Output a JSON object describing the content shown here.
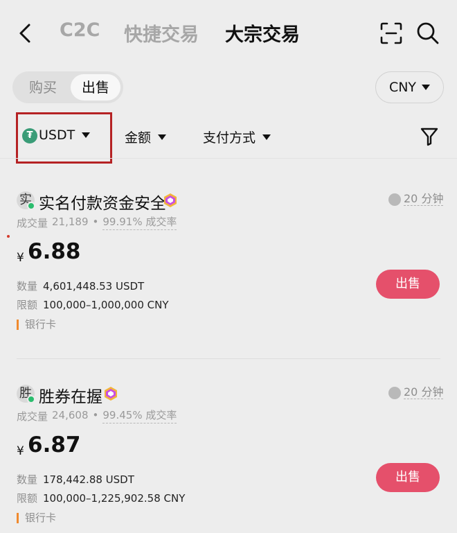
{
  "header": {
    "tabs": [
      {
        "label": "C2C",
        "active": false
      },
      {
        "label": "快捷交易",
        "active": false
      },
      {
        "label": "大宗交易",
        "active": true
      }
    ],
    "icons": [
      "back-arrow-icon",
      "scan-icon",
      "search-icon"
    ]
  },
  "toggle": {
    "buy_label": "购买",
    "sell_label": "出售",
    "selected": "出售"
  },
  "currency": {
    "selected": "CNY"
  },
  "filters": {
    "coin": {
      "label": "USDT",
      "icon_glyph": "₮"
    },
    "amount": {
      "label": "金额"
    },
    "payment": {
      "label": "支付方式"
    },
    "funnel_icon": "filter-icon"
  },
  "listings": [
    {
      "avatar_char": "实",
      "merchant": "实名付款资金安全",
      "time": "20 分钟",
      "trades_label": "成交量",
      "trades": "21,189",
      "separator": "•",
      "rate": "99.91% 成交率",
      "currency_symbol": "¥",
      "price": "6.88",
      "quantity_label": "数量",
      "quantity": "4,601,448.53 USDT",
      "limit_label": "限额",
      "limit": "100,000–1,000,000 CNY",
      "payment": "银行卡",
      "action": "出售"
    },
    {
      "avatar_char": "胜",
      "merchant": "胜券在握",
      "time": "20 分钟",
      "trades_label": "成交量",
      "trades": "24,608",
      "separator": "•",
      "rate": "99.45% 成交率",
      "currency_symbol": "¥",
      "price": "6.87",
      "quantity_label": "数量",
      "quantity": "178,442.88 USDT",
      "limit_label": "限额",
      "limit": "100,000–1,225,902.58 CNY",
      "payment": "银行卡",
      "action": "出售"
    }
  ],
  "colors": {
    "sell_button": "#e5506b",
    "highlight_box": "#b52224",
    "online": "#2bbd6e",
    "usdt": "#3a9c77",
    "payment_marker": "#f08a2e"
  }
}
